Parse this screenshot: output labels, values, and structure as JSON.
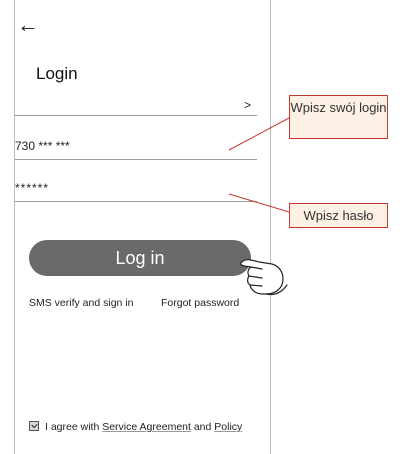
{
  "header": {
    "back_glyph": "←",
    "title": "Login"
  },
  "region": {
    "chevron": ">"
  },
  "fields": {
    "username_value": "730 *** ***",
    "password_value": "******"
  },
  "login_button": {
    "label": "Log in"
  },
  "links": {
    "sms": "SMS verify and sign in",
    "forgot": "Forgot password"
  },
  "agreement": {
    "prefix": "I agree with",
    "service": "Service Agreement",
    "and": "and",
    "policy": "Policy",
    "checked": true
  },
  "callouts": {
    "login": "Wpisz swój login",
    "password": "Wpisz hasło"
  },
  "colors": {
    "button": "#6a6a6a",
    "callout_border": "#c0392b",
    "callout_fill": "#fdf0e4"
  }
}
